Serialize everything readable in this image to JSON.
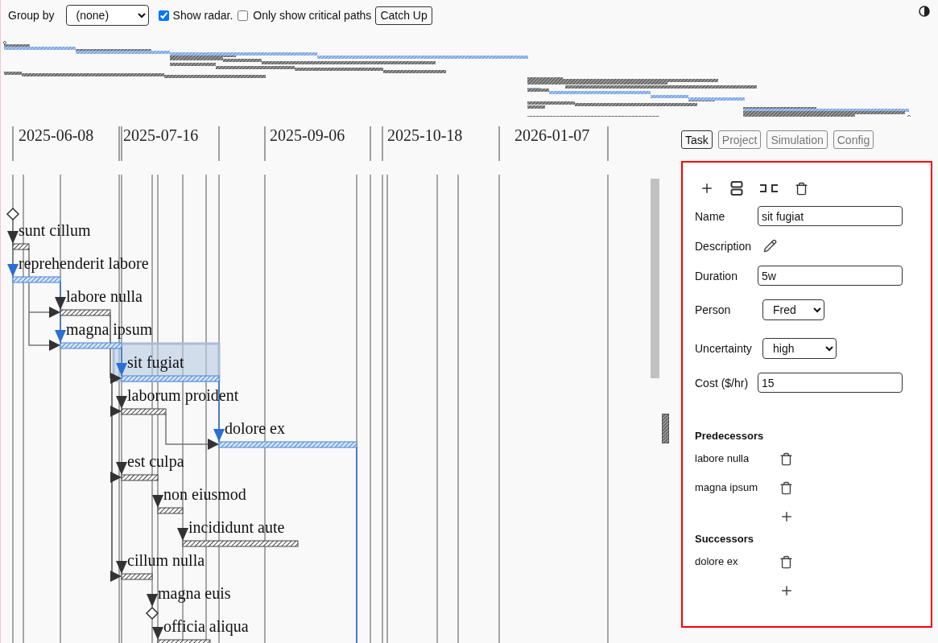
{
  "toolbar": {
    "group_by": {
      "label": "Group by",
      "value": "(none)"
    },
    "show_radar": {
      "label": "Show radar.",
      "checked": true
    },
    "critical_only": {
      "label": "Only show critical paths",
      "checked": false
    },
    "catch_up_button": "Catch Up"
  },
  "timeline": {
    "dates": [
      "2025-06-08",
      "2025-07-16",
      "2025-09-06",
      "2025-10-18",
      "2026-01-07"
    ]
  },
  "tasks": [
    {
      "kind": "milestone"
    },
    {
      "kind": "task",
      "name": "sunt cillum",
      "critical": false,
      "selected": false
    },
    {
      "kind": "task",
      "name": "reprehenderit labore",
      "critical": true,
      "selected": false
    },
    {
      "kind": "task",
      "name": "labore nulla",
      "critical": false,
      "selected": false
    },
    {
      "kind": "task",
      "name": "magna ipsum",
      "critical": true,
      "selected": false
    },
    {
      "kind": "task",
      "name": "sit fugiat",
      "critical": true,
      "selected": true
    },
    {
      "kind": "task",
      "name": "laborum proident",
      "critical": false,
      "selected": false
    },
    {
      "kind": "task",
      "name": "dolore ex",
      "critical": true,
      "selected": false
    },
    {
      "kind": "task",
      "name": "est culpa",
      "critical": false,
      "selected": false
    },
    {
      "kind": "task",
      "name": "non eiusmod",
      "critical": false,
      "selected": false
    },
    {
      "kind": "task",
      "name": "incididunt aute",
      "critical": false,
      "selected": false
    },
    {
      "kind": "task",
      "name": "cillum nulla",
      "critical": false,
      "selected": false
    },
    {
      "kind": "milestone",
      "name": "magna euis"
    },
    {
      "kind": "task",
      "name": "officia aliqua",
      "critical": false,
      "selected": false
    }
  ],
  "tabs": [
    {
      "label": "Task",
      "selected": true
    },
    {
      "label": "Project",
      "selected": false
    },
    {
      "label": "Simulation",
      "selected": false
    },
    {
      "label": "Config",
      "selected": false
    }
  ],
  "task_panel": {
    "fields": [
      {
        "kind": "text",
        "label": "Name",
        "value": "sit fugiat"
      },
      {
        "kind": "edit",
        "label": "Description"
      },
      {
        "kind": "text",
        "label": "Duration",
        "value": "5w"
      },
      {
        "kind": "select",
        "label": "Person",
        "value": "Fred"
      },
      {
        "kind": "select",
        "label": "Uncertainty",
        "value": "high"
      },
      {
        "kind": "text",
        "label": "Cost ($/hr)",
        "value": "15"
      }
    ],
    "predecessors": {
      "title": "Predecessors",
      "items": [
        "labore nulla",
        "magna ipsum"
      ]
    },
    "successors": {
      "title": "Successors",
      "items": [
        "dolore ex"
      ]
    }
  }
}
